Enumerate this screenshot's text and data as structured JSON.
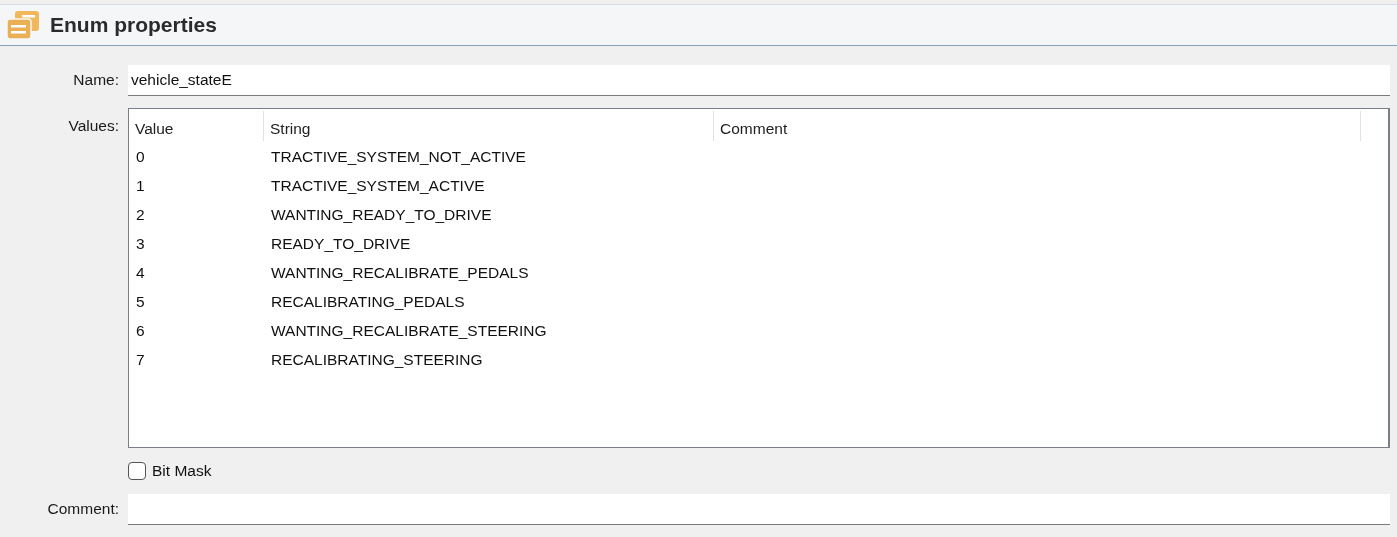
{
  "header": {
    "title": "Enum properties"
  },
  "name_field": {
    "label": "Name:",
    "value": "vehicle_stateE"
  },
  "values_table": {
    "label": "Values:",
    "columns": [
      "Value",
      "String",
      "Comment"
    ],
    "rows": [
      {
        "value": "0",
        "string": "TRACTIVE_SYSTEM_NOT_ACTIVE"
      },
      {
        "value": "1",
        "string": "TRACTIVE_SYSTEM_ACTIVE"
      },
      {
        "value": "2",
        "string": "WANTING_READY_TO_DRIVE"
      },
      {
        "value": "3",
        "string": "READY_TO_DRIVE"
      },
      {
        "value": "4",
        "string": "WANTING_RECALIBRATE_PEDALS"
      },
      {
        "value": "5",
        "string": "RECALIBRATING_PEDALS"
      },
      {
        "value": "6",
        "string": "WANTING_RECALIBRATE_STEERING"
      },
      {
        "value": "7",
        "string": "RECALIBRATING_STEERING"
      }
    ]
  },
  "bit_mask": {
    "label": "Bit Mask",
    "checked": false
  },
  "comment_field": {
    "label": "Comment:"
  }
}
